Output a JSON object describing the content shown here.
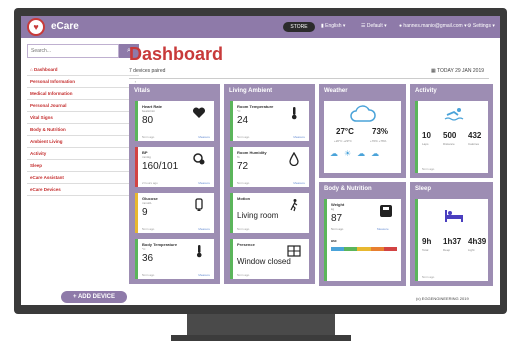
{
  "app": {
    "name": "eCare"
  },
  "topbar": {
    "toggle_label": "STORE",
    "language": "English",
    "profile": "Default",
    "user": "hannes.manio@gmail.com",
    "settings": "Settings"
  },
  "sidebar": {
    "search_placeholder": "Search...",
    "items": [
      {
        "label": "Dashboard"
      },
      {
        "label": "Personal Information"
      },
      {
        "label": "Medical Information"
      },
      {
        "label": "Personal Journal"
      },
      {
        "label": "Vital Signs"
      },
      {
        "label": "Body & Nutrition"
      },
      {
        "label": "Ambient Living"
      },
      {
        "label": "Activity"
      },
      {
        "label": "Sleep"
      },
      {
        "label": "eCare Assistant"
      },
      {
        "label": "eCare Devices"
      }
    ],
    "add_device": "+ ADD DEVICE"
  },
  "main": {
    "title": "Dashboard",
    "subtitle": "7 devices paired",
    "today": "TODAY 29 JAN 2019",
    "footer": "(c) EGGENGINEERING 2019"
  },
  "vitals": {
    "title": "Vitals",
    "cards": [
      {
        "label": "Heart Rate",
        "sub": "beats/min",
        "value": "80",
        "foot": "5min ago",
        "link": "Measure"
      },
      {
        "label": "BP",
        "sub": "mmHg",
        "value": "160/101",
        "foot": "2 hours ago",
        "link": "Measure"
      },
      {
        "label": "Glucose",
        "sub": "mmol/L",
        "value": "9",
        "foot": "5min ago",
        "link": "Measure"
      },
      {
        "label": "Body Temperature",
        "sub": "°C",
        "value": "36",
        "foot": "5min ago",
        "link": "Measure"
      }
    ]
  },
  "ambient": {
    "title": "Living Ambient",
    "cards": [
      {
        "label": "Room Temperature",
        "sub": "°C",
        "value": "24",
        "foot": "5min ago",
        "link": "Measure"
      },
      {
        "label": "Room Humidity",
        "sub": "%",
        "value": "72",
        "foot": "5min ago",
        "link": "Measure"
      },
      {
        "label": "Motion",
        "sub": "",
        "value": "Living room",
        "foot": "5min ago",
        "link": ""
      },
      {
        "label": "Presence",
        "sub": "",
        "value": "Window closed",
        "foot": "5min ago",
        "link": ""
      }
    ]
  },
  "weather": {
    "title": "Weather",
    "temp": "27°C",
    "humidity": "73%",
    "temp_range": "+20°C +29°C",
    "hum_range": "+70% +76%"
  },
  "activity": {
    "title": "Activity",
    "laps": "10",
    "laps_label": "Laps",
    "distance": "500",
    "distance_label": "Distance",
    "calories": "432",
    "calories_label": "Calories",
    "foot": "5min ago"
  },
  "body": {
    "title": "Body & Nutrition",
    "weight_label": "Weight",
    "weight_unit": "kg",
    "weight": "87",
    "weight_foot": "5min ago",
    "weight_link": "Measure",
    "bmi_label": "BMI"
  },
  "sleep": {
    "title": "Sleep",
    "total": "9h",
    "total_label": "Total",
    "deep": "1h37",
    "deep_label": "Deep",
    "light": "4h39",
    "light_label": "Light",
    "foot": "5min ago"
  },
  "colors": {
    "accent": "#8e7aa9",
    "panel": "#9d8db3",
    "brand_red": "#c83a3a"
  }
}
